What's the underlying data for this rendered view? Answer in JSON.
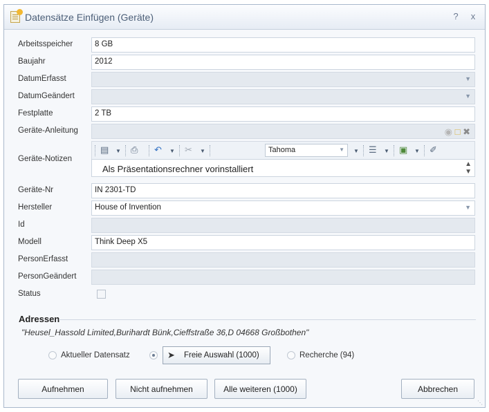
{
  "dialog": {
    "title": "Datensätze Einfügen (Geräte)",
    "help_glyph": "?",
    "close_glyph": "x"
  },
  "fields": {
    "arbeitsspeicher": {
      "label": "Arbeitsspeicher",
      "value": "8 GB"
    },
    "baujahr": {
      "label": "Baujahr",
      "value": "2012"
    },
    "datumerfasst": {
      "label": "DatumErfasst",
      "value": ""
    },
    "datumgeaendert": {
      "label": "DatumGeändert",
      "value": ""
    },
    "festplatte": {
      "label": "Festplatte",
      "value": "2 TB"
    },
    "anleitung": {
      "label": "Geräte-Anleitung",
      "value": ""
    },
    "notizen": {
      "label": "Geräte-Notizen",
      "value": "Als Präsentationsrechner vorinstalliert",
      "font": "Tahoma"
    },
    "nr": {
      "label": "Geräte-Nr",
      "value": "IN 2301-TD"
    },
    "hersteller": {
      "label": "Hersteller",
      "value": "House of Invention"
    },
    "id": {
      "label": "Id",
      "value": ""
    },
    "modell": {
      "label": "Modell",
      "value": "Think Deep X5"
    },
    "personerfasst": {
      "label": "PersonErfasst",
      "value": ""
    },
    "persongeaendert": {
      "label": "PersonGeändert",
      "value": ""
    },
    "status": {
      "label": "Status",
      "checked": false
    }
  },
  "addresses": {
    "title": "Adressen",
    "value": "\"Heusel_Hassold Limited,Burihardt Bünk,Cieffstraße 36,D 04668 Großbothen\"",
    "options": [
      {
        "label": "Aktueller Datensatz",
        "selected": false
      },
      {
        "label": "Freie Auswahl (1000)",
        "selected": true
      },
      {
        "label": "Recherche (94)",
        "selected": false
      }
    ]
  },
  "buttons": {
    "aufnehmen": "Aufnehmen",
    "nicht_aufnehmen": "Nicht aufnehmen",
    "alle_weiteren": "Alle weiteren (1000)",
    "abbrechen": "Abbrechen"
  },
  "icons": {
    "title": "document-icon",
    "freie_auswahl": "cursor-icon"
  }
}
